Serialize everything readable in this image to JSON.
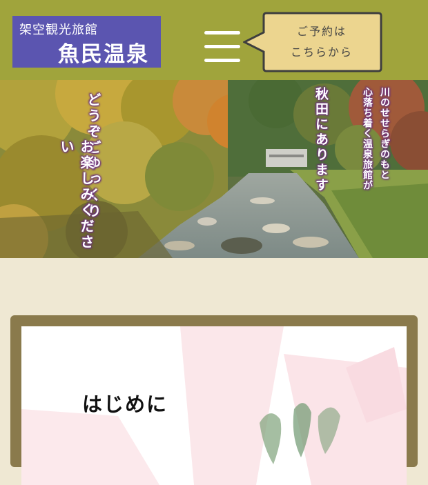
{
  "header": {
    "logo_sub": "架空観光旅館",
    "logo_main": "魚民温泉",
    "reserve_line1": "ご予約は",
    "reserve_line2": "こちらから"
  },
  "hero": {
    "caption_left_1": "どうぞごゆっくり",
    "caption_left_2": "お楽しみください",
    "caption_right_1": "川のせせらぎのもと",
    "caption_right_2": "心落ち着く温泉旅館が",
    "caption_right_3": "秋田にあります"
  },
  "section": {
    "title": "はじめに"
  },
  "colors": {
    "header_bg": "#a0a43c",
    "logo_bg": "#5b55b0",
    "bubble_bg": "#ecd58f",
    "page_bg": "#efe8d3",
    "card_border": "#8a7a4c"
  }
}
